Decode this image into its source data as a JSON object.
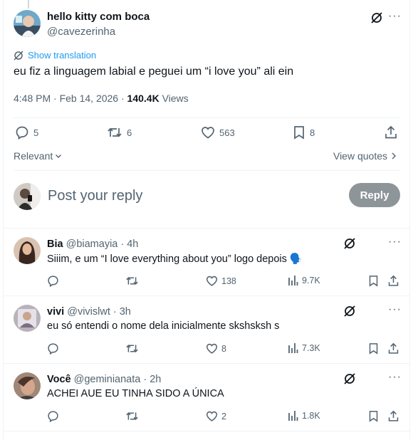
{
  "post": {
    "author_name": "hello kitty com boca",
    "author_handle": "@cavezerinha",
    "translate_label": "Show translation",
    "text": "eu fiz a linguagem labial e peguei um “i love you” ali ein",
    "time": "4:48 PM · Feb 14, 2026 · ",
    "views_count": "140.4K",
    "views_label": " Views",
    "stats": {
      "replies": "5",
      "reposts": "6",
      "likes": "563",
      "bookmarks": "8"
    }
  },
  "sort": {
    "relevant_label": "Relevant",
    "view_quotes_label": "View quotes"
  },
  "composer": {
    "placeholder": "Post your reply",
    "button_label": "Reply"
  },
  "replies": [
    {
      "name": "Bia",
      "handle": "@biamayia",
      "time": "· 4h",
      "text": "Siiim, e um “I love everything about you” logo depois 🗣️",
      "likes": "138",
      "views": "9.7K"
    },
    {
      "name": "vivi",
      "handle": "@vivislwt",
      "time": "· 3h",
      "text": "eu só entendi o nome dela inicialmente skshsksh s",
      "likes": "8",
      "views": "7.3K"
    },
    {
      "name": "Você",
      "handle": "@geminianata",
      "time": "· 2h",
      "text": "ACHEI AUE EU TINHA SIDO A ÚNICA",
      "likes": "2",
      "views": "1.8K"
    }
  ],
  "colors": {
    "link": "#1d9bf0",
    "muted": "#536471",
    "text": "#0f1419",
    "divider": "#eff3f4",
    "reply_button_disabled": "#8e9599"
  }
}
